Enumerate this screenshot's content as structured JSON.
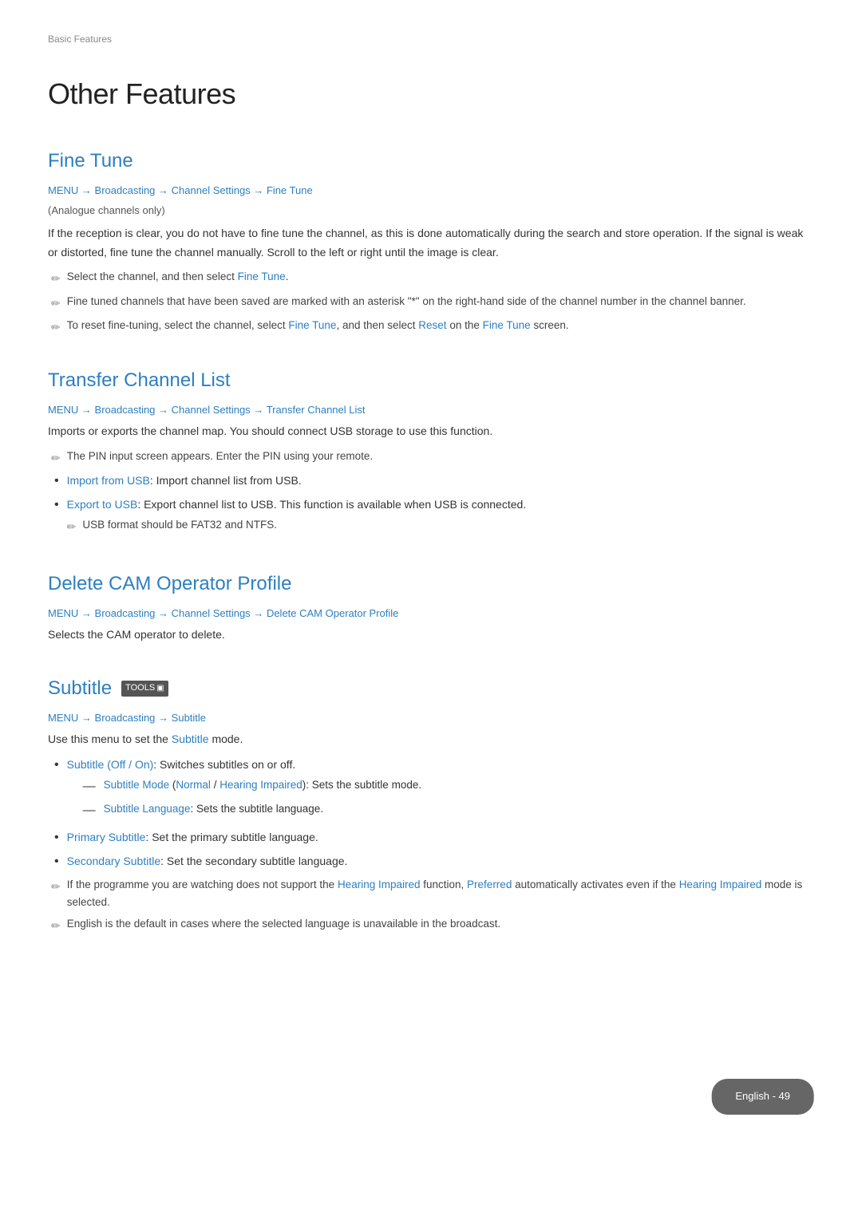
{
  "breadcrumb": "Basic Features",
  "page_title": "Other Features",
  "sections": {
    "fine_tune": {
      "title": "Fine Tune",
      "menu_path": "MENU → Broadcasting → Channel Settings → Fine Tune",
      "subtitle": "(Analogue channels only)",
      "description": "If the reception is clear, you do not have to fine tune the channel, as this is done automatically during the search and store operation. If the signal is weak or distorted, fine tune the channel manually. Scroll to the left or right until the image is clear.",
      "notes": [
        "Select the channel, and then select Fine Tune.",
        "Fine tuned channels that have been saved are marked with an asterisk \"*\" on the right-hand side of the channel number in the channel banner.",
        "To reset fine-tuning, select the channel, select Fine Tune, and then select Reset on the Fine Tune screen."
      ],
      "notes_highlights": [
        [
          "Fine Tune"
        ],
        [
          "Fine Tune"
        ],
        [
          "Fine Tune",
          "Reset",
          "Fine Tune"
        ]
      ]
    },
    "transfer_channel_list": {
      "title": "Transfer Channel List",
      "menu_path": "MENU → Broadcasting → Channel Settings → Transfer Channel List",
      "description": "Imports or exports the channel map. You should connect USB storage to use this function.",
      "pencil_note": "The PIN input screen appears. Enter the PIN using your remote.",
      "bullets": [
        {
          "text": "Import from USB: Import channel list from USB.",
          "highlights": [
            "Import from USB"
          ]
        },
        {
          "text": "Export to USB: Export channel list to USB. This function is available when USB is connected.",
          "highlights": [
            "Export to USB"
          ],
          "sub_pencil": "USB format should be FAT32 and NTFS."
        }
      ]
    },
    "delete_cam": {
      "title": "Delete CAM Operator Profile",
      "menu_path": "MENU → Broadcasting → Channel Settings → Delete CAM Operator Profile",
      "description": "Selects the CAM operator to delete."
    },
    "subtitle": {
      "title": "Subtitle",
      "tools_badge": "TOOLS",
      "menu_path": "MENU → Broadcasting → Subtitle",
      "description": "Use this menu to set the Subtitle mode.",
      "bullets": [
        {
          "text": "Subtitle (Off / On): Switches subtitles on or off.",
          "highlights": [
            "Subtitle (Off / On)"
          ],
          "sub_bullets": [
            {
              "text": "Subtitle Mode (Normal / Hearing Impaired): Sets the subtitle mode.",
              "highlights": [
                "Subtitle Mode",
                "Normal",
                "Hearing Impaired"
              ]
            },
            {
              "text": "Subtitle Language: Sets the subtitle language.",
              "highlights": [
                "Subtitle Language"
              ]
            }
          ]
        },
        {
          "text": "Primary Subtitle: Set the primary subtitle language.",
          "highlights": [
            "Primary Subtitle"
          ]
        },
        {
          "text": "Secondary Subtitle: Set the secondary subtitle language.",
          "highlights": [
            "Secondary Subtitle"
          ]
        }
      ],
      "pencil_notes": [
        {
          "text": "If the programme you are watching does not support the Hearing Impaired function, Preferred automatically activates even if the Hearing Impaired mode is selected.",
          "highlights": [
            "Hearing Impaired",
            "Preferred",
            "Hearing Impaired"
          ]
        },
        {
          "text": "English is the default in cases where the selected language is unavailable in the broadcast.",
          "highlights": []
        }
      ]
    }
  },
  "footer": {
    "text": "English - 49"
  }
}
